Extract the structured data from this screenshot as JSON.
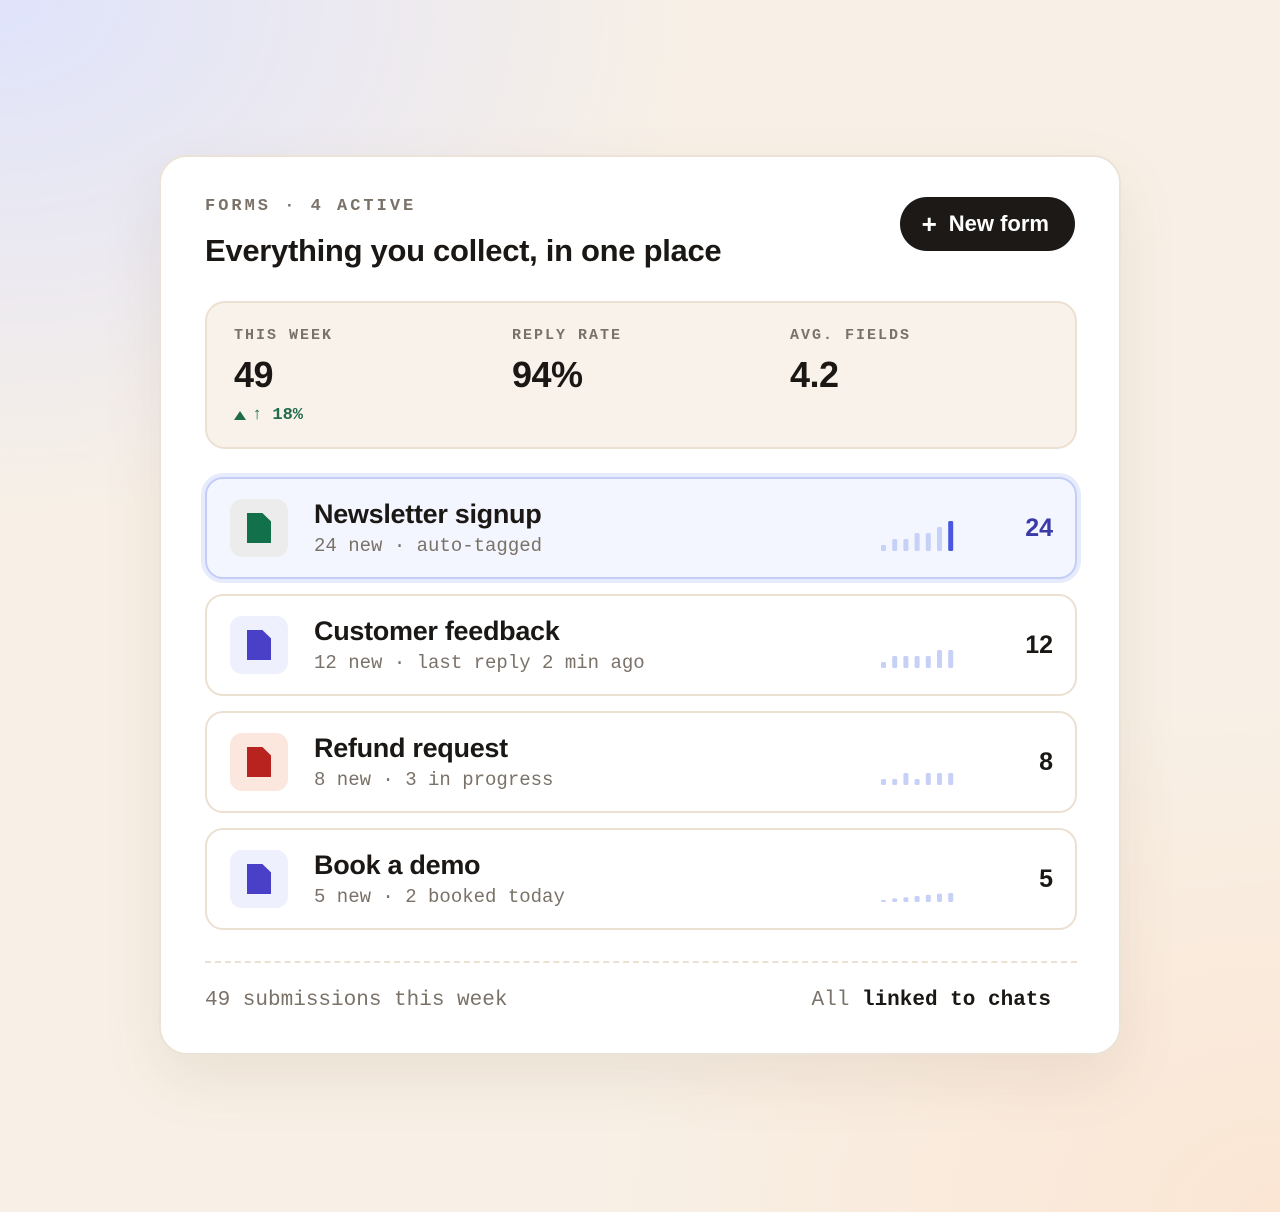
{
  "header": {
    "eyebrow": "FORMS · 4 ACTIVE",
    "title": "Everything you collect, in one place",
    "new_button": {
      "icon": "plus-icon",
      "label": "New form"
    }
  },
  "stats": [
    {
      "label": "THIS WEEK",
      "value": "49",
      "delta": "↑ 18%",
      "delta_color": "#1f6b4a"
    },
    {
      "label": "REPLY RATE",
      "value": "94%"
    },
    {
      "label": "AVG. FIELDS",
      "value": "4.2"
    }
  ],
  "forms": [
    {
      "name": "Newsletter signup",
      "subtitle": "24 new · auto-tagged",
      "count": "24",
      "icon": "document-icon",
      "icon_color": "#12704a",
      "icon_bg": "#ececec",
      "selected": true,
      "activity": [
        1,
        2,
        2,
        3,
        3,
        4,
        5
      ]
    },
    {
      "name": "Customer feedback",
      "subtitle": "12 new · last reply 2 min ago",
      "count": "12",
      "icon": "document-icon",
      "icon_color": "#4a3fc7",
      "icon_bg": "#eef0fd",
      "selected": false,
      "activity": [
        1,
        2,
        2,
        2,
        2,
        3,
        3
      ]
    },
    {
      "name": "Refund request",
      "subtitle": "8 new · 3 in progress",
      "count": "8",
      "icon": "document-icon",
      "icon_color": "#b8221f",
      "icon_bg": "#fbe7de",
      "selected": false,
      "activity": [
        1,
        1,
        2,
        1,
        2,
        2,
        2
      ]
    },
    {
      "name": "Book a demo",
      "subtitle": "5 new · 2 booked today",
      "count": "5",
      "icon": "document-icon",
      "icon_color": "#4a3fc7",
      "icon_bg": "#eef0fd",
      "selected": false,
      "activity": [
        0.3,
        0.6,
        0.8,
        1,
        1.2,
        1.4,
        1.5
      ]
    }
  ],
  "footer": {
    "left": "49 submissions this week",
    "right_prefix": "All",
    "right_emphasis": "linked to chats"
  },
  "colors": {
    "accent": "#3a3aa8",
    "spark_active": "#4a57e0",
    "spark_light": "#c7d0f7",
    "button_bg": "#1c1917"
  }
}
